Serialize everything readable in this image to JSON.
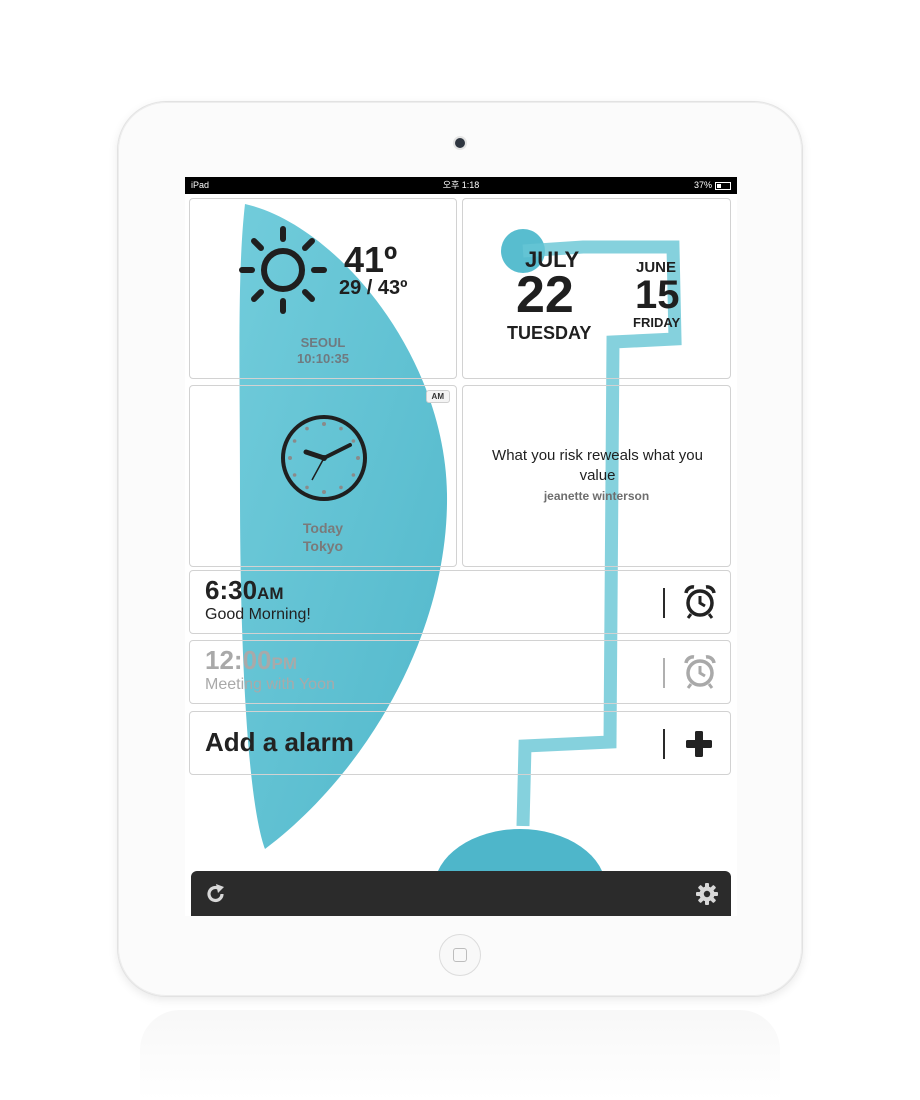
{
  "statusbar": {
    "carrier": "iPad",
    "time": "오후 1:18",
    "battery": "37%"
  },
  "weather": {
    "temp": "41º",
    "range": "29 / 43º",
    "city": "SEOUL",
    "time": "10:10:35",
    "icon": "sun-icon"
  },
  "date": {
    "primary": {
      "month": "JULY",
      "day": "22",
      "weekday": "TUESDAY"
    },
    "secondary": {
      "month": "JUNE",
      "day": "15",
      "weekday": "FRIDAY"
    }
  },
  "clock": {
    "ampm": "AM",
    "day": "Today",
    "city": "Tokyo",
    "icon": "analog-clock-icon"
  },
  "quote": {
    "text": "What you risk reweals what you value",
    "author": "jeanette winterson"
  },
  "alarms": [
    {
      "time": "6:30",
      "suffix": "AM",
      "label": "Good Morning!",
      "active": true
    },
    {
      "time": "12:00",
      "suffix": "PM",
      "label": "Meeting with Yoon",
      "active": false
    }
  ],
  "add_alarm": {
    "label": "Add a alarm",
    "icon": "plus-icon"
  },
  "toolbar": {
    "left_icon": "refresh-icon",
    "right_icon": "gear-icon"
  },
  "colors": {
    "accent": "#4ab8cc",
    "bar": "#2b2b2b",
    "text": "#1f1f1f"
  }
}
